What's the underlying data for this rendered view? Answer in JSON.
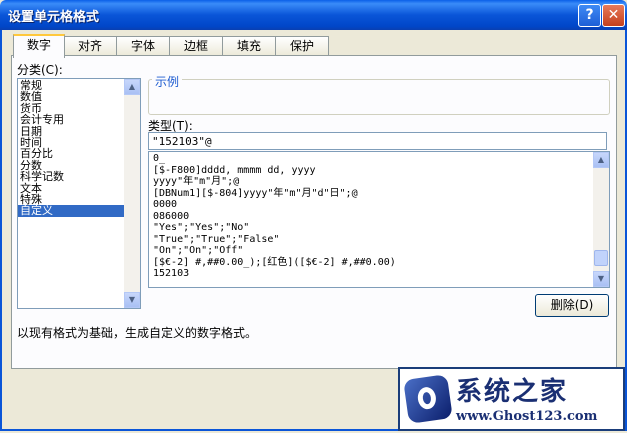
{
  "window": {
    "title": "设置单元格格式",
    "help_glyph": "?",
    "close_glyph": "✕"
  },
  "tabs": [
    {
      "label": "数字",
      "active": true
    },
    {
      "label": "对齐"
    },
    {
      "label": "字体"
    },
    {
      "label": "边框"
    },
    {
      "label": "填充"
    },
    {
      "label": "保护"
    }
  ],
  "category": {
    "label": "分类(C):",
    "items": [
      "常规",
      "数值",
      "货币",
      "会计专用",
      "日期",
      "时间",
      "百分比",
      "分数",
      "科学记数",
      "文本",
      "特殊",
      "自定义"
    ],
    "selected_index": 11
  },
  "sample": {
    "title": "示例",
    "value": ""
  },
  "type": {
    "label": "类型(T):",
    "value": "\"152103\"@"
  },
  "formats": [
    "0_",
    "[$-F800]dddd, mmmm dd, yyyy",
    "yyyy\"年\"m\"月\";@",
    "[DBNum1][$-804]yyyy\"年\"m\"月\"d\"日\";@",
    "0000",
    "086000",
    "\"Yes\";\"Yes\";\"No\"",
    "\"True\";\"True\";\"False\"",
    "\"On\";\"On\";\"Off\"",
    "[$€-2] #,##0.00_);[红色]([$€-2] #,##0.00)",
    "152103"
  ],
  "buttons": {
    "delete_label": "删除(D)"
  },
  "description": "以现有格式为基础，生成自定义的数字格式。",
  "watermark": {
    "name": "系统之家",
    "url": "www.Ghost123.com"
  },
  "colors": {
    "titlebar": "#0a55d8",
    "selection": "#316ac5",
    "dialog_bg": "#ece9d8",
    "panel_bg": "#fcfcfe"
  }
}
